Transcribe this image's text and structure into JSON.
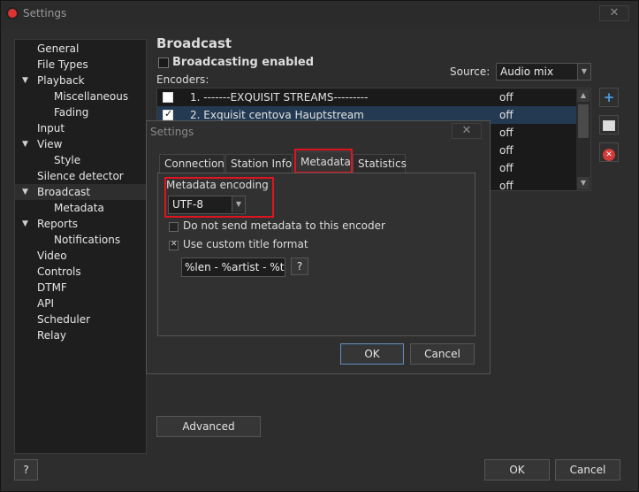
{
  "window": {
    "title": "Settings",
    "close": "✕"
  },
  "sidebar": {
    "items": [
      {
        "label": "General"
      },
      {
        "label": "File Types"
      },
      {
        "label": "Playback"
      },
      {
        "label": "Miscellaneous"
      },
      {
        "label": "Fading"
      },
      {
        "label": "Input"
      },
      {
        "label": "View"
      },
      {
        "label": "Style"
      },
      {
        "label": "Silence detector"
      },
      {
        "label": "Broadcast"
      },
      {
        "label": "Metadata"
      },
      {
        "label": "Reports"
      },
      {
        "label": "Notifications"
      },
      {
        "label": "Video"
      },
      {
        "label": "Controls"
      },
      {
        "label": "DTMF"
      },
      {
        "label": "API"
      },
      {
        "label": "Scheduler"
      },
      {
        "label": "Relay"
      }
    ],
    "help": "?"
  },
  "broadcast": {
    "title": "Broadcast",
    "enabled_label": "Broadcasting enabled",
    "encoders_label": "Encoders:",
    "source_label": "Source:",
    "source_value": "Audio mix",
    "encoders": [
      {
        "name": "1. -------EXQUISIT STREAMS---------",
        "status": "off"
      },
      {
        "name": "2. Exquisit centova Hauptstream",
        "status": "off"
      },
      {
        "name": "",
        "status": "off"
      },
      {
        "name": "",
        "status": "off"
      },
      {
        "name": "",
        "status": "off"
      },
      {
        "name": "",
        "status": "off"
      }
    ],
    "advanced": "Advanced"
  },
  "dialog": {
    "title": "Settings",
    "close": "✕",
    "tabs": [
      "Connection",
      "Station Info",
      "Metadata",
      "Statistics"
    ],
    "metadata_encoding_label": "Metadata encoding",
    "encoding_value": "UTF-8",
    "no_send_label": "Do not send metadata to this encoder",
    "custom_title_label": "Use custom title format",
    "title_format": "%len - %artist - %ti",
    "help": "?",
    "ok": "OK",
    "cancel": "Cancel"
  },
  "footer": {
    "ok": "OK",
    "cancel": "Cancel"
  },
  "colors": {
    "highlight": "#e0141f",
    "selection": "#233a52",
    "add": "#4a9be0",
    "remove": "#d33a3a"
  }
}
